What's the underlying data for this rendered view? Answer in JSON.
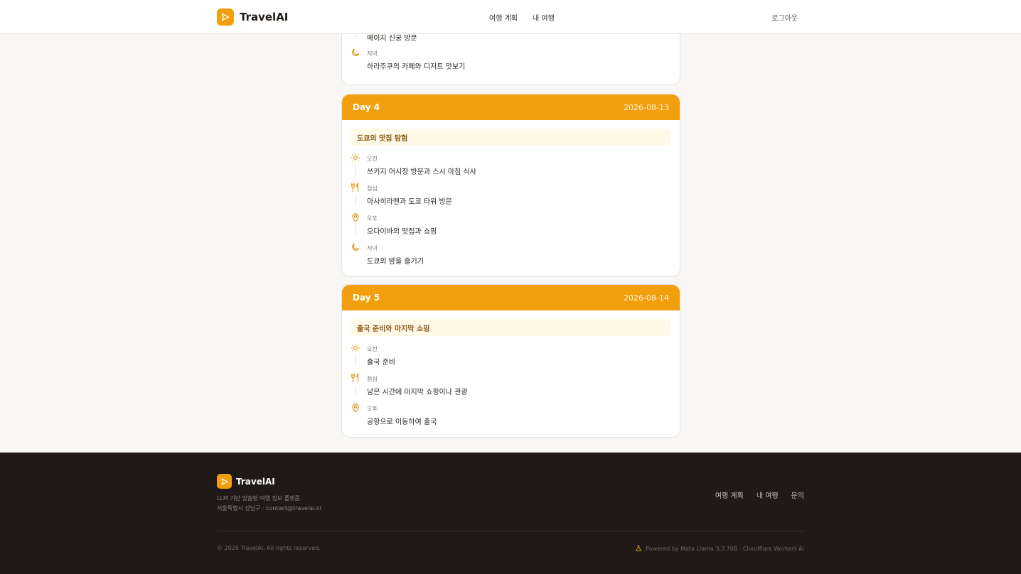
{
  "header": {
    "brand": "TravelAI",
    "nav": [
      "여행 계획",
      "내 여행"
    ],
    "logout": "로그아웃"
  },
  "top_card": {
    "slots": [
      {
        "time": "",
        "desc": "메이지 신궁 방문",
        "icon": "sun-icon"
      },
      {
        "time": "저녁",
        "desc": "하라주쿠의 카페와 디저트 맛보기",
        "icon": "moon-icon"
      }
    ]
  },
  "days": [
    {
      "label": "Day 4",
      "date": "2026-08-13",
      "theme": "도쿄의 맛집 탐험",
      "slots": [
        {
          "time": "오전",
          "desc": "쓰키지 어시장 방문과 스시 아침 식사",
          "icon": "sun-icon"
        },
        {
          "time": "점심",
          "desc": "아사히라멘과 도쿄 타워 방문",
          "icon": "utensils-icon"
        },
        {
          "time": "오후",
          "desc": "오다이바의 맛집과 쇼핑",
          "icon": "map-pin-icon"
        },
        {
          "time": "저녁",
          "desc": "도쿄의 밤을 즐기기",
          "icon": "moon-icon"
        }
      ]
    },
    {
      "label": "Day 5",
      "date": "2026-08-14",
      "theme": "출국 준비와 마지막 쇼핑",
      "slots": [
        {
          "time": "오전",
          "desc": "출국 준비",
          "icon": "sun-icon"
        },
        {
          "time": "점심",
          "desc": "남은 시간에 마지막 쇼핑이나 관광",
          "icon": "utensils-icon"
        },
        {
          "time": "오후",
          "desc": "공항으로 이동하여 출국",
          "icon": "map-pin-icon"
        }
      ]
    }
  ],
  "footer": {
    "brand": "TravelAI",
    "desc_line1": "LLM 기반 맞춤형 여행 정보 플랫폼.",
    "desc_line2": "서울특별시 강남구 · contact@travelai.kr",
    "links": [
      "여행 계획",
      "내 여행",
      "문의"
    ],
    "copyright": "© 2026 TravelAI. All rights reserved.",
    "powered": "Powered by Meta Llama 3.3 70B · Cloudflare Workers AI"
  },
  "colors": {
    "accent": "#f29f0d",
    "theme_bg": "#fff9e8",
    "footer_bg": "#1f1a17"
  }
}
